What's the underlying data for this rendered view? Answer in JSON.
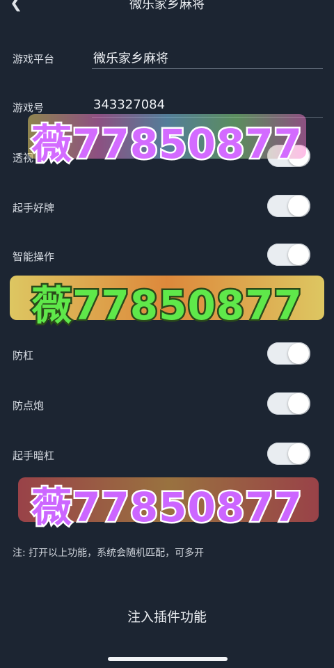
{
  "header": {
    "back_icon": "chevron-left-icon",
    "title": "微乐家乡麻将"
  },
  "form": {
    "platform_label": "游戏平台",
    "platform_value": "微乐家乡麻将",
    "account_label": "游戏号",
    "account_value": "343327084"
  },
  "toggles": [
    {
      "label": "透视",
      "on": false
    },
    {
      "label": "起手好牌",
      "on": false
    },
    {
      "label": "智能操作",
      "on": false
    },
    {
      "label": "防杠",
      "on": false
    },
    {
      "label": "防点炮",
      "on": false
    },
    {
      "label": "起手暗杠",
      "on": false
    }
  ],
  "note": "注: 打开以上功能，系统会随机匹配，可多开",
  "inject_label": "注入插件功能",
  "watermark": "薇77850877",
  "colors": {
    "background": "#1c2532",
    "toggle_track": "#e9edf1",
    "text": "#e6e8ec"
  }
}
